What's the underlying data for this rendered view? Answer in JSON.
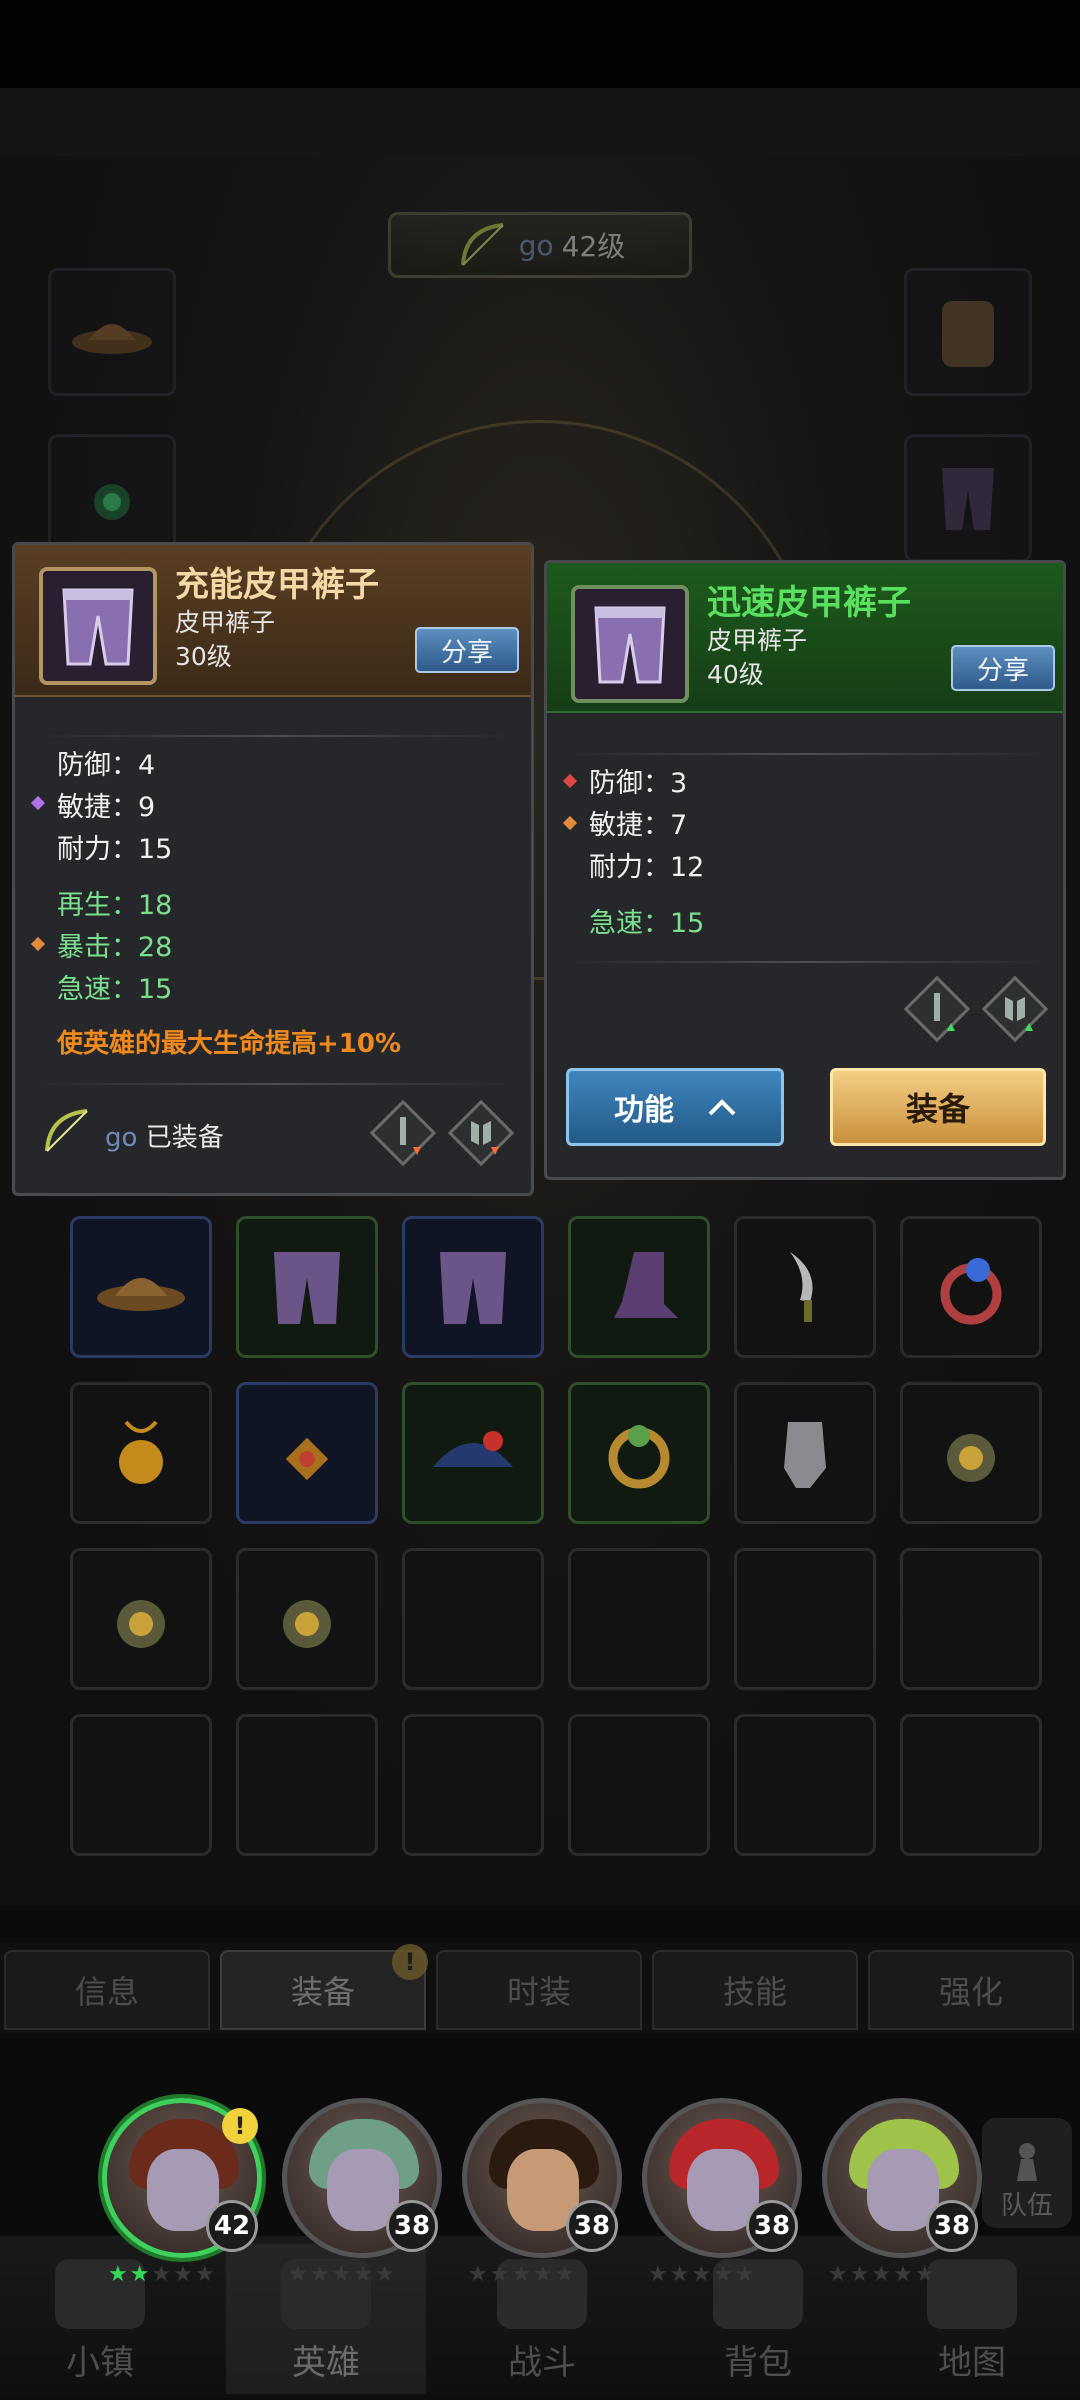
{
  "hero_header": {
    "hero_name": "go",
    "hero_level": "42级"
  },
  "current_item": {
    "name": "充能皮甲裤子",
    "type": "皮甲裤子",
    "level": "30级",
    "share_label": "分享",
    "base_stats": [
      {
        "name": "防御",
        "value": "4"
      },
      {
        "name": "敏捷",
        "value": "9"
      },
      {
        "name": "耐力",
        "value": "15"
      }
    ],
    "bonus_stats": [
      {
        "name": "再生",
        "value": "18"
      },
      {
        "name": "暴击",
        "value": "28"
      },
      {
        "name": "急速",
        "value": "15"
      }
    ],
    "effect": "使英雄的最大生命提高+10%",
    "equipped_by": "go",
    "equipped_label": "已装备"
  },
  "new_item": {
    "name": "迅速皮甲裤子",
    "type": "皮甲裤子",
    "level": "40级",
    "share_label": "分享",
    "base_stats": [
      {
        "name": "防御",
        "value": "3"
      },
      {
        "name": "敏捷",
        "value": "7"
      },
      {
        "name": "耐力",
        "value": "12"
      }
    ],
    "bonus_stats": [
      {
        "name": "急速",
        "value": "15"
      }
    ],
    "function_button": "功能",
    "equip_button": "装备"
  },
  "tabs": [
    "信息",
    "装备",
    "时装",
    "技能",
    "强化"
  ],
  "heroes": [
    {
      "level": "42",
      "stars_on": 2,
      "hair": "#6b2a1a"
    },
    {
      "level": "38",
      "stars_on": 0,
      "hair": "#6f9f86"
    },
    {
      "level": "38",
      "stars_on": 0,
      "hair": "#2b1a10"
    },
    {
      "level": "38",
      "stars_on": 0,
      "hair": "#b8262a"
    },
    {
      "level": "38",
      "stars_on": 0,
      "hair": "#9fc24a"
    }
  ],
  "team_label": "队伍",
  "nav": [
    "小镇",
    "英雄",
    "战斗",
    "背包",
    "地图"
  ],
  "colors": {
    "current_title": "#f4d9a6",
    "new_title": "#59e05f",
    "bonus_stat": "#7be08e",
    "effect": "#f08a1c"
  }
}
